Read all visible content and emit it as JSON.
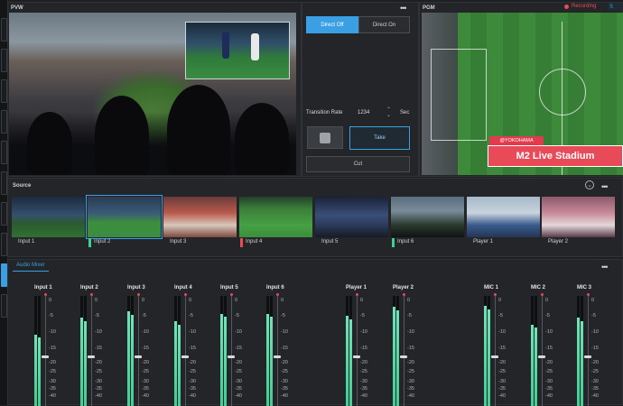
{
  "pvw": {
    "label": "PVW",
    "more_icon": "more-dots-icon"
  },
  "pgm": {
    "label": "PGM",
    "recording": "Recording",
    "partial_button": "S",
    "overlay_tag": "@YOKOHAMA",
    "overlay_title": "M2 Live Stadium"
  },
  "control": {
    "direct_off": "Direct Off",
    "direct_on": "Direct On",
    "transition_rate_label": "Transition Rate",
    "transition_rate_value": "1234",
    "transition_rate_unit": "Sec",
    "auto_icon": "auto-transition-icon",
    "take": "Take",
    "cut": "Cut"
  },
  "source": {
    "label": "Source",
    "inputs": [
      {
        "label": "Input 1",
        "tally": ""
      },
      {
        "label": "Input 2",
        "tally": "#3fcf94"
      },
      {
        "label": "Input 3",
        "tally": ""
      },
      {
        "label": "Input 4",
        "tally": "#e84a58"
      },
      {
        "label": "Input 5",
        "tally": ""
      },
      {
        "label": "Input 6",
        "tally": "#3fcf94"
      },
      {
        "label": "Player 1",
        "tally": ""
      },
      {
        "label": "Player 2",
        "tally": ""
      }
    ]
  },
  "audio": {
    "tab": "Audio Mixer",
    "scale": [
      "0",
      "-5",
      "-10",
      "-15",
      "-20",
      "-25",
      "-30",
      "-35",
      "-40"
    ],
    "channels": [
      {
        "label": "Input 1",
        "level": 0.65
      },
      {
        "label": "Input 2",
        "level": 0.8
      },
      {
        "label": "Input 3",
        "level": 0.86
      },
      {
        "label": "Input 4",
        "level": 0.77
      },
      {
        "label": "Input 5",
        "level": 0.84
      },
      {
        "label": "Input 6",
        "level": 0.84
      },
      {
        "label": "Player 1",
        "level": 0.82
      },
      {
        "label": "Player 2",
        "level": 0.9
      },
      {
        "label": "MIC 1",
        "level": 0.91
      },
      {
        "label": "MIC 2",
        "level": 0.74
      },
      {
        "label": "MIC 3",
        "level": 0.8
      }
    ]
  },
  "colors": {
    "accent": "#3a9fe3",
    "live": "#e84a58",
    "meter": "#3fcf94"
  }
}
